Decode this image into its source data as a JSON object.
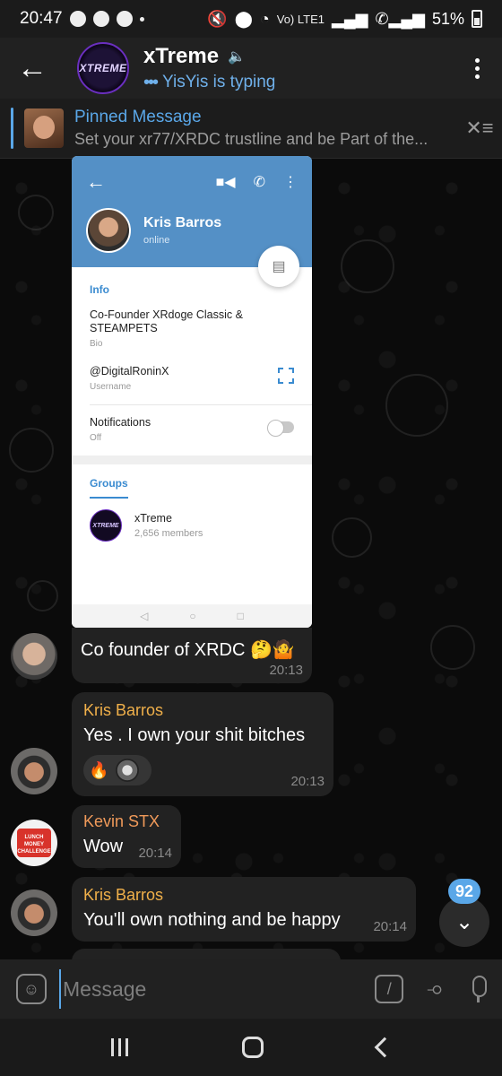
{
  "status_bar": {
    "time": "20:47",
    "lte": "Vo) LTE1",
    "battery": "51%"
  },
  "header": {
    "title": "xTreme",
    "avatar_text": "XTREME",
    "typing_indicator": "•••",
    "typing": "YisYis is typing"
  },
  "pinned": {
    "title": "Pinned Message",
    "text": "Set your xr77/XRDC trustline and be Part of the..."
  },
  "screenshot": {
    "name": "Kris Barros",
    "status": "online",
    "info_title": "Info",
    "bio_value": "Co-Founder XRdoge Classic & STEAMPETS",
    "bio_label": "Bio",
    "username_value": "@DigitalRoninX",
    "username_label": "Username",
    "notif_value": "Notifications",
    "notif_label": "Off",
    "groups_tab": "Groups",
    "group_avatar_text": "XTREME",
    "group_name": "xTreme",
    "group_members": "2,656 members"
  },
  "messages": [
    {
      "sender": "",
      "text": "Co founder of XRDC 🤔🤷",
      "time": "20:13"
    },
    {
      "sender": "Kris Barros",
      "text": "Yes . I own your shit bitches",
      "time": "20:13",
      "reaction": "🔥"
    },
    {
      "sender": "Kevin STX",
      "text": "Wow",
      "time": "20:14",
      "avatar_text": "LUNCH MONEY CHALLENGE"
    },
    {
      "sender": "Kris Barros",
      "text": "You'll own nothing and be happy",
      "time": "20:14"
    }
  ],
  "colors": {
    "sender_kris": "#f0b04a",
    "sender_kevin": "#f09a5a",
    "accent": "#5aa7e8"
  },
  "unread_count": "92",
  "input": {
    "placeholder": "Message"
  },
  "icons": [
    "back-arrow-icon",
    "mute-icon",
    "more-icon",
    "unpin-icon",
    "sticker-icon",
    "command-icon",
    "attach-icon",
    "mic-icon",
    "chevron-down-icon"
  ]
}
